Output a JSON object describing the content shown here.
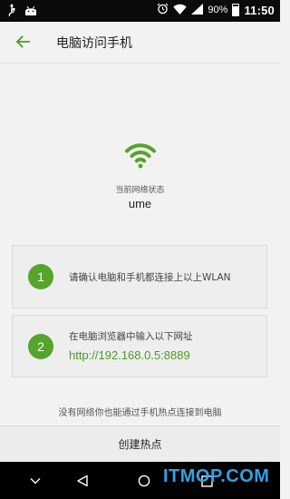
{
  "status_bar": {
    "battery_percent": "90%",
    "time": "11:50",
    "icons": [
      "usb-icon",
      "android-icon",
      "alarm-icon",
      "wifi-icon",
      "cell-signal-icon",
      "battery-icon"
    ]
  },
  "app_bar": {
    "title": "电脑访问手机",
    "back_icon": "arrow-left-icon"
  },
  "network": {
    "label": "当前网络状态",
    "name": "ume",
    "icon": "wifi-icon"
  },
  "steps": [
    {
      "number": "1",
      "text": "请确认电脑和手机都连接上以上WLAN"
    },
    {
      "number": "2",
      "text": "在电脑浏览器中输入以下网址",
      "url": "http://192.168.0.5:8889"
    }
  ],
  "hotspot_hint": "没有网络你也能通过手机热点连接到电脑",
  "hotspot_button": "创建热点",
  "nav_bar": {
    "icons": [
      "collapse-icon",
      "back-icon",
      "home-icon",
      "recents-icon"
    ]
  },
  "watermark": "ITMOP.COM",
  "colors": {
    "accent": "#55a42c",
    "url": "#4d9a25",
    "background": "#f2f2f2"
  }
}
